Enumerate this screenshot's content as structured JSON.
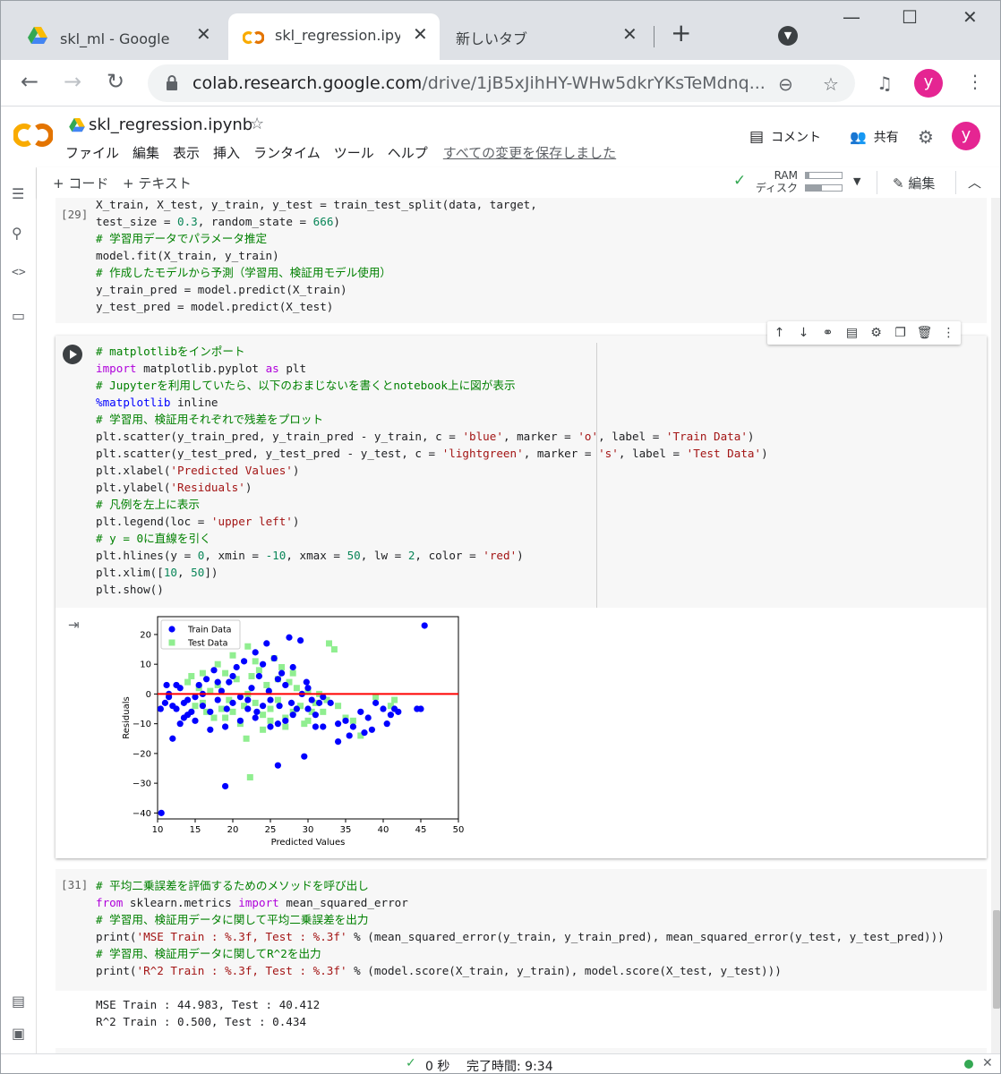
{
  "browser": {
    "tabs": [
      {
        "label": "skl_ml - Google ド",
        "icon": "drive-icon"
      },
      {
        "label": "skl_regression.ipyn",
        "icon": "colab-icon"
      },
      {
        "label": "新しいタブ",
        "icon": ""
      }
    ],
    "url_domain": "colab.research.google.com",
    "url_path": "/drive/1jB5xJihHY-WHw5dkrYKsTeMdnq...",
    "avatar_letter": "y"
  },
  "colab": {
    "notebook_title": "skl_regression.ipynb",
    "menu": [
      "ファイル",
      "編集",
      "表示",
      "挿入",
      "ランタイム",
      "ツール",
      "ヘルプ"
    ],
    "saved_status": "すべての変更を保存しました",
    "comment_label": "コメント",
    "share_label": "共有",
    "avatar_letter": "y",
    "toolbar": {
      "add_code": "+ コード",
      "add_text": "+ テキスト",
      "ram_label": "RAM",
      "disk_label": "ディスク",
      "ram_usage": 0.1,
      "disk_usage": 0.45,
      "edit_label": "編集"
    }
  },
  "cells": {
    "cell29": {
      "prompt": "[29]",
      "lines": [
        "X_train, X_test, y_train, y_test = train_test_split(data, target,",
        "test_size = 0.3, random_state = 666)",
        "# 学習用データでパラメータ推定",
        "model.fit(X_train, y_train)",
        "# 作成したモデルから予測（学習用、検証用モデル使用）",
        "y_train_pred = model.predict(X_train)",
        "y_test_pred = model.predict(X_test)"
      ]
    },
    "cell30": {
      "lines": [
        "# matplotlibをインポート",
        "import matplotlib.pyplot as plt",
        "# Jupyterを利用していたら、以下のおまじないを書くとnotebook上に図が表示",
        "%matplotlib inline",
        "# 学習用、検証用それぞれで残差をプロット",
        "plt.scatter(y_train_pred, y_train_pred - y_train, c = 'blue', marker = 'o', label = 'Train Data')",
        "plt.scatter(y_test_pred, y_test_pred - y_test, c = 'lightgreen', marker = 's', label = 'Test Data')",
        "plt.xlabel('Predicted Values')",
        "plt.ylabel('Residuals')",
        "# 凡例を左上に表示",
        "plt.legend(loc = 'upper left')",
        "# y = 0に直線を引く",
        "plt.hlines(y = 0, xmin = -10, xmax = 50, lw = 2, color = 'red')",
        "plt.xlim([10, 50])",
        "plt.show()"
      ]
    },
    "cell31": {
      "prompt": "[31]",
      "lines": [
        "# 平均二乗誤差を評価するためのメソッドを呼び出し",
        "from sklearn.metrics import mean_squared_error",
        "# 学習用、検証用データに関して平均二乗誤差を出力",
        "print('MSE Train : %.3f, Test : %.3f' % (mean_squared_error(y_train, y_train_pred), mean_squared_error(y_test, y_test_pred)))",
        "# 学習用、検証用データに関してR^2を出力",
        "print('R^2 Train : %.3f, Test : %.3f' % (model.score(X_train, y_train), model.score(X_test, y_test)))"
      ],
      "output": [
        "MSE Train : 44.983, Test : 40.412",
        "R^2 Train : 0.500, Test : 0.434"
      ]
    }
  },
  "status": {
    "elapsed": "0 秒",
    "completed": "完了時間: 9:34"
  },
  "chart_data": {
    "type": "scatter",
    "xlabel": "Predicted Values",
    "ylabel": "Residuals",
    "xlim": [
      10,
      50
    ],
    "ylim": [
      -42,
      26
    ],
    "xticks": [
      10,
      15,
      20,
      25,
      30,
      35,
      40,
      45,
      50
    ],
    "yticks": [
      -40,
      -30,
      -20,
      -10,
      0,
      10,
      20
    ],
    "legend_position": "upper-left",
    "hline": {
      "y": 0,
      "color": "#ff0000"
    },
    "series": [
      {
        "name": "Train Data",
        "color": "#0000ff",
        "marker": "circle",
        "points": [
          [
            10.5,
            -40
          ],
          [
            10.4,
            -5
          ],
          [
            11,
            -3
          ],
          [
            11.2,
            3
          ],
          [
            11.5,
            -1
          ],
          [
            12,
            -4
          ],
          [
            12.5,
            -5
          ],
          [
            13,
            2
          ],
          [
            13.5,
            -3
          ],
          [
            14,
            -2
          ],
          [
            14.5,
            -6
          ],
          [
            15,
            -1
          ],
          [
            15.5,
            3
          ],
          [
            16,
            -4
          ],
          [
            16.5,
            5
          ],
          [
            17,
            -6
          ],
          [
            17.5,
            8
          ],
          [
            18,
            -2
          ],
          [
            18.5,
            1
          ],
          [
            19,
            -31
          ],
          [
            19.2,
            -5
          ],
          [
            19.5,
            4
          ],
          [
            20,
            -3
          ],
          [
            20.5,
            9
          ],
          [
            21,
            -1
          ],
          [
            21.5,
            11
          ],
          [
            22,
            -5
          ],
          [
            22.5,
            2
          ],
          [
            23,
            14
          ],
          [
            23.2,
            -6
          ],
          [
            23.5,
            6
          ],
          [
            24,
            -4
          ],
          [
            24.5,
            17
          ],
          [
            24.8,
            1
          ],
          [
            25,
            -2
          ],
          [
            25.5,
            12
          ],
          [
            26,
            -24
          ],
          [
            26.2,
            -4
          ],
          [
            26.5,
            7
          ],
          [
            27,
            3
          ],
          [
            27.5,
            19
          ],
          [
            27.8,
            -3
          ],
          [
            28,
            9
          ],
          [
            28.5,
            -5
          ],
          [
            29,
            18
          ],
          [
            29.2,
            0
          ],
          [
            29.5,
            -21
          ],
          [
            29.8,
            4
          ],
          [
            30,
            -5
          ],
          [
            30.5,
            -2
          ],
          [
            31,
            -7
          ],
          [
            31.5,
            -3
          ],
          [
            32,
            -1
          ],
          [
            33,
            -3
          ],
          [
            34,
            -10
          ],
          [
            34,
            -16
          ],
          [
            35,
            -9
          ],
          [
            35.5,
            -14
          ],
          [
            36,
            -11
          ],
          [
            37,
            -6
          ],
          [
            37.5,
            -13
          ],
          [
            38,
            -8
          ],
          [
            38.5,
            -12
          ],
          [
            39,
            -3
          ],
          [
            40,
            -5
          ],
          [
            40.5,
            -10
          ],
          [
            41,
            -7
          ],
          [
            41.5,
            -5
          ],
          [
            42,
            -6
          ],
          [
            44.5,
            -5
          ],
          [
            45,
            -5
          ],
          [
            45.5,
            23
          ],
          [
            12,
            -15
          ],
          [
            13,
            -10
          ],
          [
            17,
            -12
          ],
          [
            21,
            -9
          ],
          [
            26,
            -10
          ],
          [
            32,
            -11
          ],
          [
            11.5,
            0
          ],
          [
            12.5,
            3
          ],
          [
            13.5,
            -8
          ],
          [
            15,
            -9
          ],
          [
            16,
            0
          ],
          [
            18,
            4
          ],
          [
            20,
            6
          ],
          [
            22,
            -2
          ],
          [
            24,
            10
          ],
          [
            26,
            5
          ],
          [
            28,
            -7
          ],
          [
            30,
            2
          ],
          [
            27,
            -9
          ],
          [
            25,
            -11
          ],
          [
            23,
            -8
          ],
          [
            19,
            -11
          ],
          [
            14,
            -7
          ],
          [
            31,
            -11
          ]
        ]
      },
      {
        "name": "Test Data",
        "color": "#90ee90",
        "marker": "square",
        "points": [
          [
            14,
            4
          ],
          [
            14.5,
            6
          ],
          [
            15,
            -4
          ],
          [
            15.5,
            2
          ],
          [
            16,
            -3
          ],
          [
            16.5,
            -6
          ],
          [
            17,
            1
          ],
          [
            17.5,
            -8
          ],
          [
            18,
            3
          ],
          [
            18.5,
            -5
          ],
          [
            19,
            7
          ],
          [
            19.5,
            -2
          ],
          [
            20,
            -6
          ],
          [
            20.5,
            5
          ],
          [
            21,
            -10
          ],
          [
            21.5,
            -4
          ],
          [
            21.8,
            -15
          ],
          [
            22,
            0
          ],
          [
            22.3,
            -28
          ],
          [
            22.5,
            6
          ],
          [
            23,
            -3
          ],
          [
            23.5,
            8
          ],
          [
            24,
            -7
          ],
          [
            24.5,
            3
          ],
          [
            25,
            -5
          ],
          [
            25.5,
            12
          ],
          [
            26,
            -2
          ],
          [
            26.5,
            9
          ],
          [
            27,
            -8
          ],
          [
            27.5,
            4
          ],
          [
            28,
            -6
          ],
          [
            28.5,
            2
          ],
          [
            29,
            -4
          ],
          [
            29.5,
            -10
          ],
          [
            30,
            1
          ],
          [
            30.5,
            -6
          ],
          [
            31,
            -3
          ],
          [
            31.5,
            0
          ],
          [
            32,
            -6
          ],
          [
            32.5,
            -2
          ],
          [
            32.8,
            17
          ],
          [
            33.5,
            15
          ],
          [
            34,
            -4
          ],
          [
            35,
            -8
          ],
          [
            36,
            -9
          ],
          [
            39,
            -1
          ],
          [
            41,
            -4
          ],
          [
            41.5,
            -2
          ],
          [
            37,
            -14
          ],
          [
            18,
            10
          ],
          [
            20,
            13
          ],
          [
            22,
            16
          ],
          [
            23,
            11
          ],
          [
            16,
            7
          ],
          [
            28,
            7
          ],
          [
            25,
            -9
          ],
          [
            27,
            -11
          ],
          [
            24,
            -12
          ],
          [
            19,
            -8
          ],
          [
            26,
            5
          ],
          [
            30,
            -9
          ]
        ]
      }
    ]
  }
}
